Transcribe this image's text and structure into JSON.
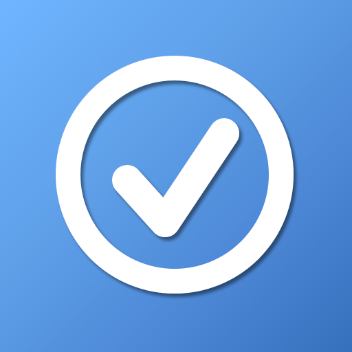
{
  "icon": {
    "name": "checkmark-circle-icon",
    "colors": {
      "background_light": "#6fb5ff",
      "background_dark": "#3570bd",
      "foreground": "#ffffff",
      "shadow": "#8a9fb5"
    }
  }
}
